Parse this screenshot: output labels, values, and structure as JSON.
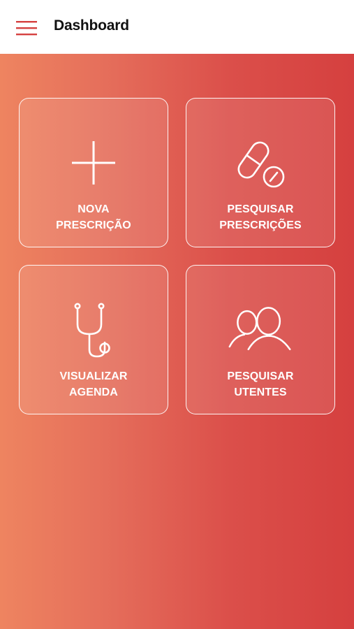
{
  "header": {
    "menu_icon": "hamburger-icon",
    "title": "Dashboard"
  },
  "colors": {
    "accent": "#d5403f",
    "gradient_start": "#ee8460",
    "gradient_end": "#d5403f"
  },
  "tiles": [
    {
      "icon": "plus-icon",
      "label_line1": "NOVA",
      "label_line2": "PRESCRIÇÃO"
    },
    {
      "icon": "pill-icon",
      "label_line1": "PESQUISAR",
      "label_line2": "PRESCRIÇÕES"
    },
    {
      "icon": "stethoscope-icon",
      "label_line1": "VISUALIZAR",
      "label_line2": "AGENDA"
    },
    {
      "icon": "users-icon",
      "label_line1": "PESQUISAR",
      "label_line2": "UTENTES"
    }
  ]
}
